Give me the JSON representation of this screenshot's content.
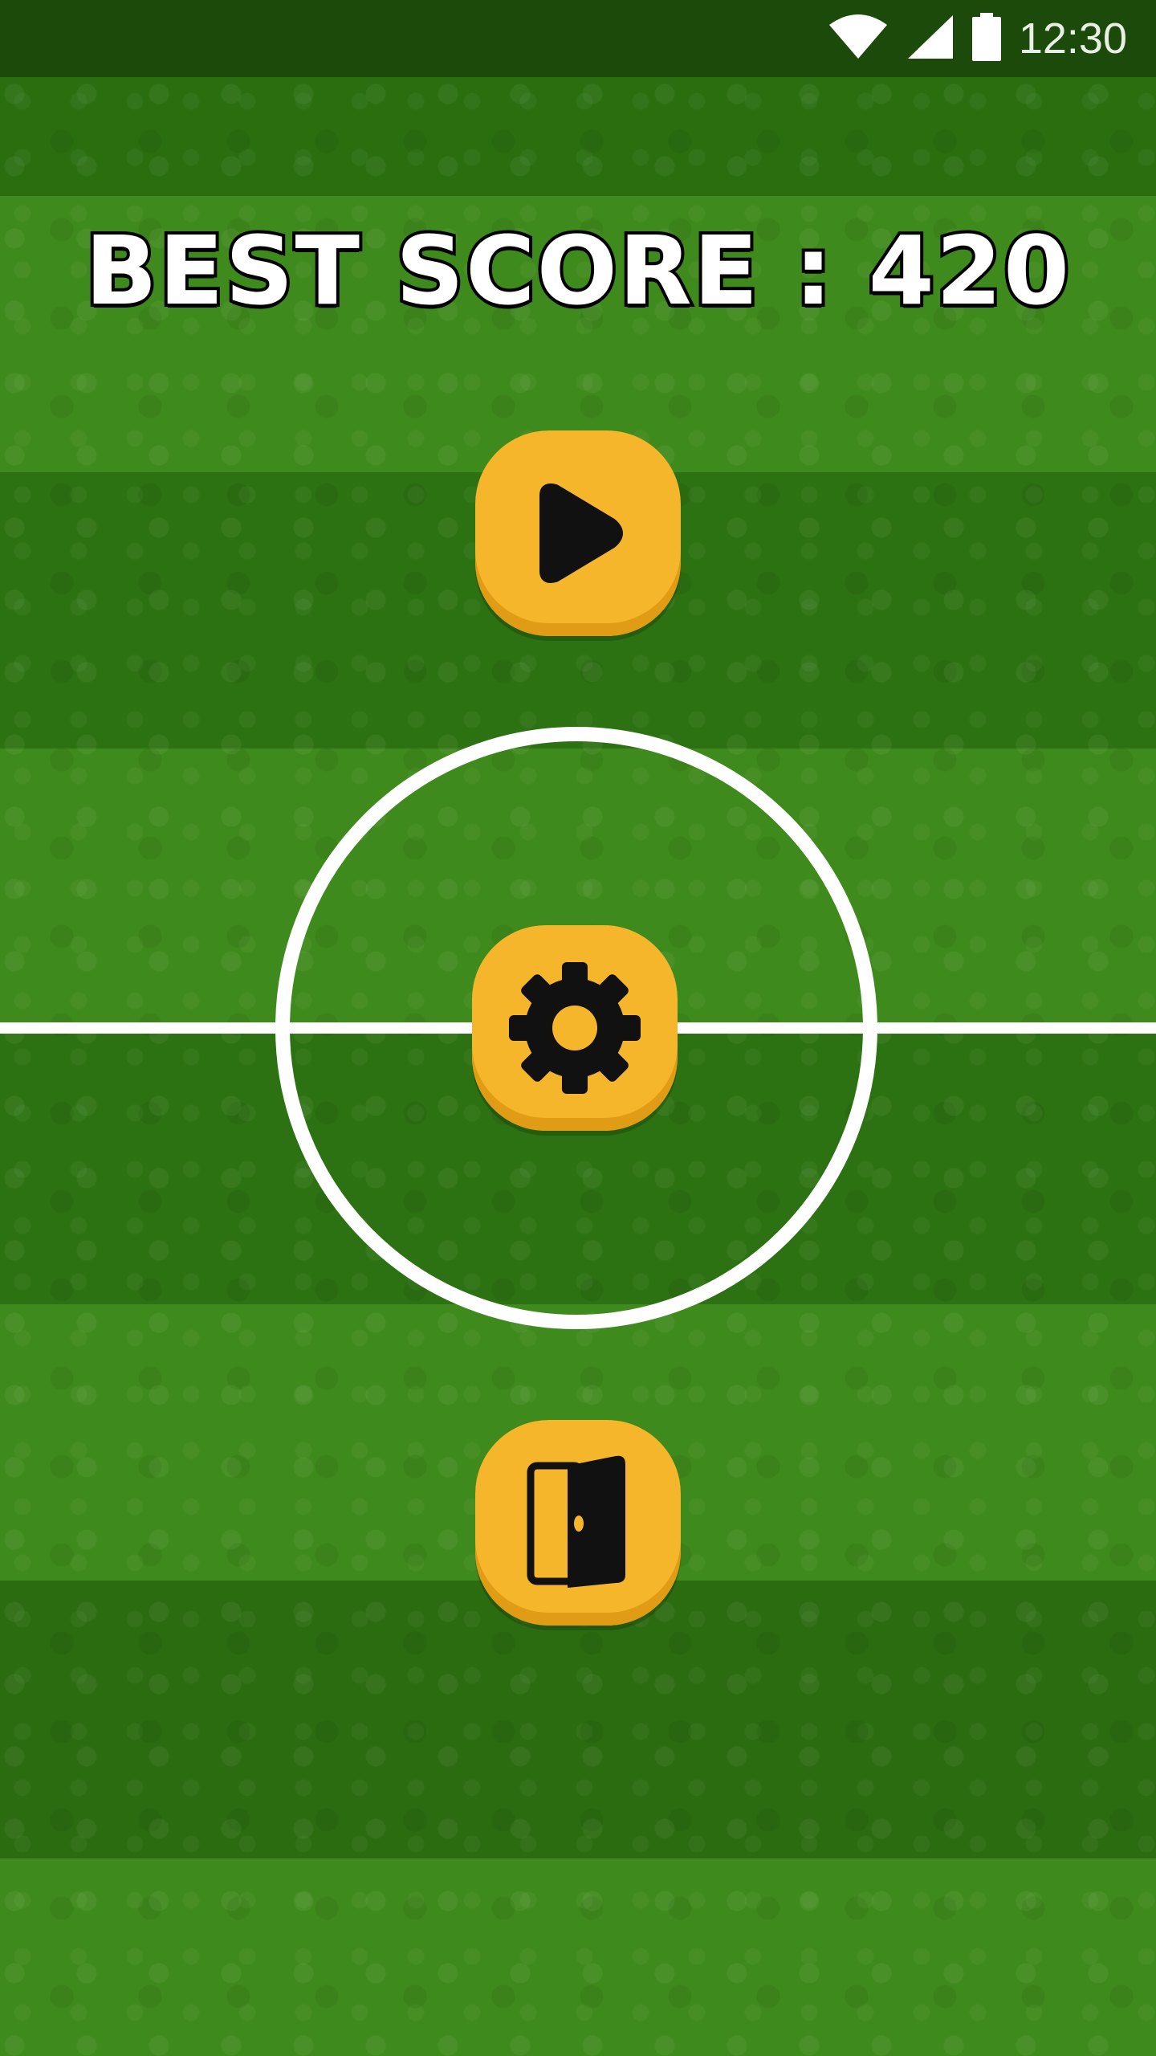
{
  "status_bar": {
    "time": "12:30",
    "icons": [
      "wifi-icon",
      "signal-icon",
      "battery-icon"
    ]
  },
  "header": {
    "best_score_text": "BEST SCORE : 420"
  },
  "menu": {
    "buttons": [
      {
        "name": "play",
        "icon": "play-icon"
      },
      {
        "name": "settings",
        "icon": "gear-icon"
      },
      {
        "name": "exit",
        "icon": "door-exit-icon"
      }
    ]
  },
  "colors": {
    "field_dark": "#2d7212",
    "field_light": "#3f8a1c",
    "button": "#f6b62c",
    "icon": "#111111",
    "line": "#ffffff"
  }
}
